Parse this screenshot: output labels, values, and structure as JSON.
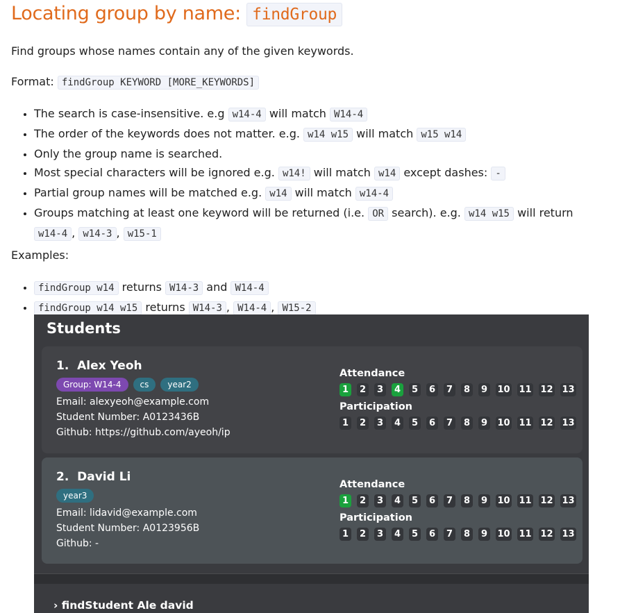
{
  "heading": {
    "text": "Locating group by name: ",
    "code": "findGroup"
  },
  "intro": "Find groups whose names contain any of the given keywords.",
  "format": {
    "label": "Format:",
    "code": "findGroup KEYWORD [MORE_KEYWORDS]"
  },
  "bullets": {
    "b1": {
      "t1": "The search is case-insensitive. e.g",
      "c1": "w14-4",
      "t2": "will match",
      "c2": "W14-4"
    },
    "b2": {
      "t1": "The order of the keywords does not matter. e.g.",
      "c1": "w14 w15",
      "t2": "will match",
      "c2": "w15 w14"
    },
    "b3": {
      "t1": "Only the group name is searched."
    },
    "b4": {
      "t1": "Most special characters will be ignored e.g.",
      "c1": "w14!",
      "t2": "will match",
      "c2": "w14",
      "t3": "except dashes:",
      "c3": "-"
    },
    "b5": {
      "t1": "Partial group names will be matched e.g.",
      "c1": "w14",
      "t2": "will match",
      "c2": "w14-4"
    },
    "b6": {
      "t1": "Groups matching at least one keyword will be returned (i.e.",
      "c1": "OR",
      "t2": "search). e.g.",
      "c2": "w14 w15",
      "t3": "will return",
      "c3": "w14-4",
      "c4": "w14-3",
      "c5": "w15-1",
      "sep": ","
    }
  },
  "examples_label": "Examples:",
  "examples": {
    "e1": {
      "c1": "findGroup w14",
      "t1": "returns",
      "c2": "W14-3",
      "t2": "and",
      "c3": "W14-4"
    },
    "e2": {
      "c1": "findGroup w14 w15",
      "t1": "returns",
      "c2": "W14-3",
      "c3": "W14-4",
      "c4": "W15-2",
      "sep": ","
    }
  },
  "app": {
    "title": "Students",
    "attendance_label": "Attendance",
    "participation_label": "Participation",
    "weeks": [
      "1",
      "2",
      "3",
      "4",
      "5",
      "6",
      "7",
      "8",
      "9",
      "10",
      "11",
      "12",
      "13"
    ],
    "students": [
      {
        "index": "1.",
        "name": "Alex Yeoh",
        "tags": [
          "Group: W14-4",
          "cs",
          "year2"
        ],
        "email": "Email: alexyeoh@example.com",
        "student_number": "Student Number: A0123436B",
        "github": "Github: https://github.com/ayeoh/ip",
        "attended_weeks": [
          "1",
          "4"
        ]
      },
      {
        "index": "2.",
        "name": "David Li",
        "tags": [
          "year3"
        ],
        "email": "Email: lidavid@example.com",
        "student_number": "Student Number: A0123956B",
        "github": "Github: -",
        "attended_weeks": [
          "1"
        ]
      }
    ],
    "command": "› findStudent Ale david",
    "colors": {
      "attended": "#1aa13d",
      "group_tag": "#7d49b0",
      "tag": "#2f6f80"
    }
  }
}
